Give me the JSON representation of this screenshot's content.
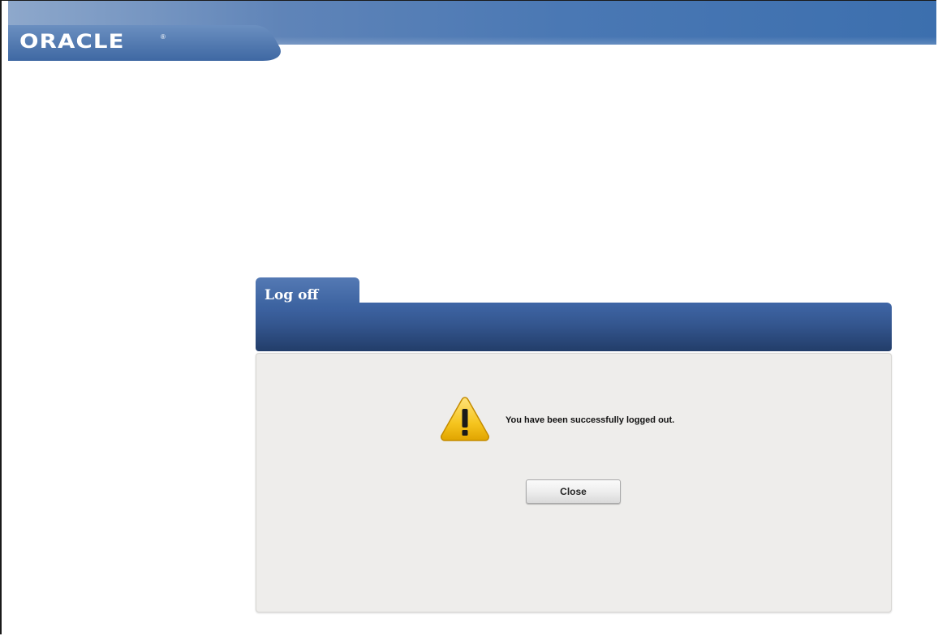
{
  "header": {
    "logo_text": "ORACLE",
    "logo_mark": "®"
  },
  "dialog": {
    "tab_title": "Log off",
    "icon": "warning-icon",
    "message": "You have been successfully logged out.",
    "close_label": "Close"
  },
  "colors": {
    "banner_blue": "#3a6fb0",
    "dialog_header": "#34568f",
    "dialog_body": "#eeedeb",
    "warning_yellow": "#f4c21a"
  }
}
